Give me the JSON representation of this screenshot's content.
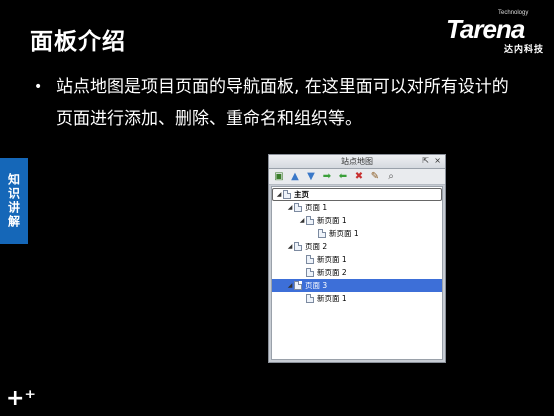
{
  "slide": {
    "title": "面板介绍",
    "bullet_mark": "•",
    "bullet_text": "站点地图是项目页面的导航面板, 在这里面可以对所有设计的页面进行添加、删除、重命名和组织等。",
    "side_tab": "知识讲解",
    "deco": "+⁺"
  },
  "logo": {
    "tech": "Technology",
    "word": "Tarena",
    "cn": "达内科技"
  },
  "panel": {
    "title": "站点地图",
    "pin_glyph": "⇱",
    "close_glyph": "×",
    "toolbar": [
      {
        "icon": "add-page-icon",
        "glyph": "▣",
        "color": "#3a7d2a"
      },
      {
        "icon": "move-up-icon",
        "glyph": "▲",
        "color": "#3a78c8"
      },
      {
        "icon": "move-down-icon",
        "glyph": "▼",
        "color": "#3a78c8"
      },
      {
        "icon": "indent-icon",
        "glyph": "➡",
        "color": "#3aa03a"
      },
      {
        "icon": "outdent-icon",
        "glyph": "⬅",
        "color": "#3aa03a"
      },
      {
        "icon": "delete-icon",
        "glyph": "✖",
        "color": "#c83030"
      },
      {
        "icon": "rename-icon",
        "glyph": "✎",
        "color": "#8a5a20"
      },
      {
        "icon": "search-icon",
        "glyph": "⌕",
        "color": "#555555"
      }
    ],
    "tree": [
      {
        "label": "主页",
        "level": 0,
        "expanded": true,
        "root": true
      },
      {
        "label": "页面 1",
        "level": 1,
        "expanded": true
      },
      {
        "label": "新页面 1",
        "level": 2,
        "expanded": true
      },
      {
        "label": "新页面 1",
        "level": 3,
        "expanded": false
      },
      {
        "label": "页面 2",
        "level": 1,
        "expanded": true
      },
      {
        "label": "新页面 1",
        "level": 2,
        "expanded": false
      },
      {
        "label": "新页面 2",
        "level": 2,
        "expanded": false
      },
      {
        "label": "页面 3",
        "level": 1,
        "expanded": true,
        "selected": true
      },
      {
        "label": "新页面 1",
        "level": 2,
        "expanded": false
      }
    ]
  }
}
